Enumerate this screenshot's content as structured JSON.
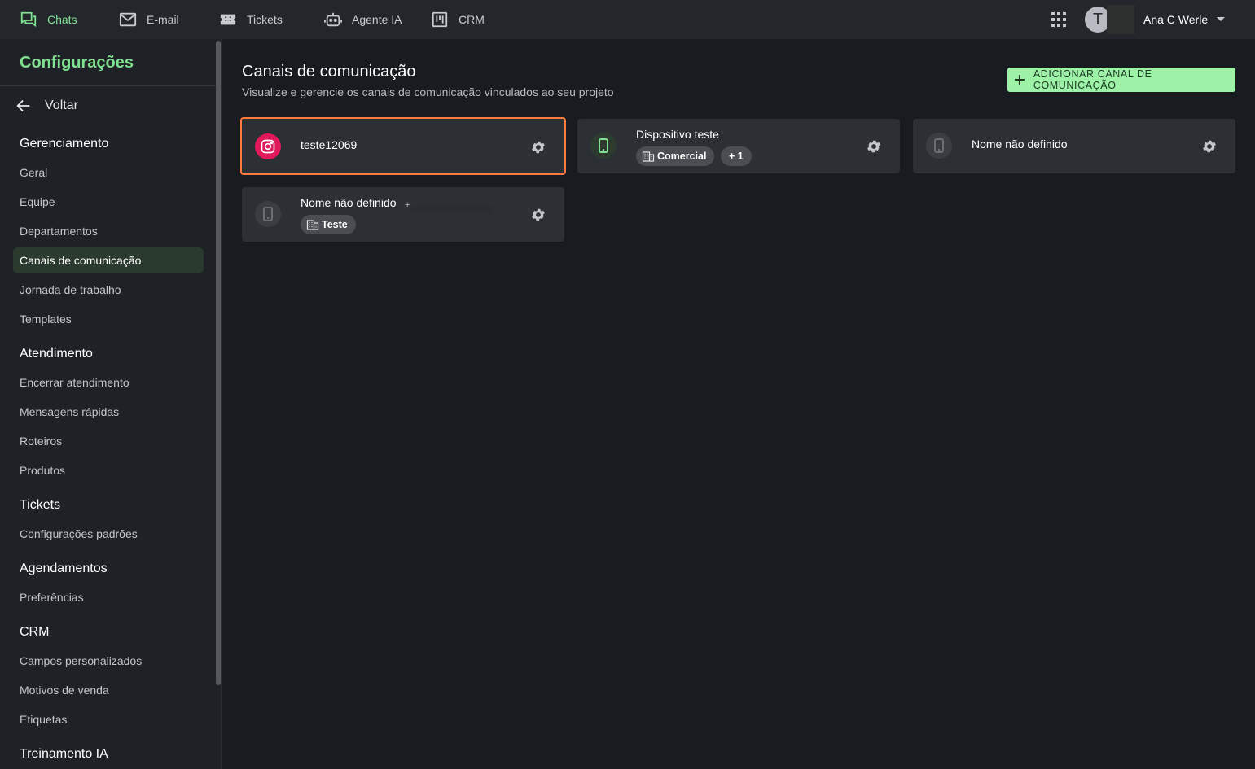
{
  "topnav": {
    "items": [
      {
        "label": "Chats",
        "icon": "chat-icon",
        "active": true
      },
      {
        "label": "E-mail",
        "icon": "mail-icon"
      },
      {
        "label": "Tickets",
        "icon": "ticket-icon"
      },
      {
        "label": "Agente IA",
        "icon": "robot-icon"
      },
      {
        "label": "CRM",
        "icon": "kanban-icon"
      }
    ],
    "avatar_initial": "T",
    "user_name": "Ana C Werle"
  },
  "sidebar": {
    "title": "Configurações",
    "back_label": "Voltar",
    "sections": [
      {
        "heading": "Gerenciamento",
        "items": [
          "Geral",
          "Equipe",
          "Departamentos",
          "Canais de comunicação",
          "Jornada de trabalho",
          "Templates"
        ]
      },
      {
        "heading": "Atendimento",
        "items": [
          "Encerrar atendimento",
          "Mensagens rápidas",
          "Roteiros",
          "Produtos"
        ]
      },
      {
        "heading": "Tickets",
        "items": [
          "Configurações padrões"
        ]
      },
      {
        "heading": "Agendamentos",
        "items": [
          "Preferências"
        ]
      },
      {
        "heading": "CRM",
        "items": [
          "Campos personalizados",
          "Motivos de venda",
          "Etiquetas"
        ]
      },
      {
        "heading": "Treinamento IA",
        "items": []
      }
    ],
    "active_item": "Canais de comunicação"
  },
  "main": {
    "title": "Canais de comunicação",
    "subtitle": "Visualize e gerencie os canais de comunicação vinculados ao seu projeto",
    "add_button": "ADICIONAR CANAL DE COMUNICAÇÃO",
    "channels": [
      {
        "name": "teste12069",
        "icon": "instagram-icon",
        "selected": true
      },
      {
        "name": "Dispositivo teste",
        "icon": "phone-icon",
        "chips": [
          "Comercial",
          "+ 1"
        ]
      },
      {
        "name": "Nome não definido",
        "icon": "phone-icon"
      },
      {
        "name": "Nome não definido",
        "icon": "phone-icon",
        "extra": "+",
        "chips": [
          "Teste"
        ]
      }
    ]
  },
  "colors": {
    "accent": "#7fe08f",
    "button_bg": "#9ef2a8",
    "selected_border": "#ff7a3d",
    "instagram": "#e0195b"
  }
}
